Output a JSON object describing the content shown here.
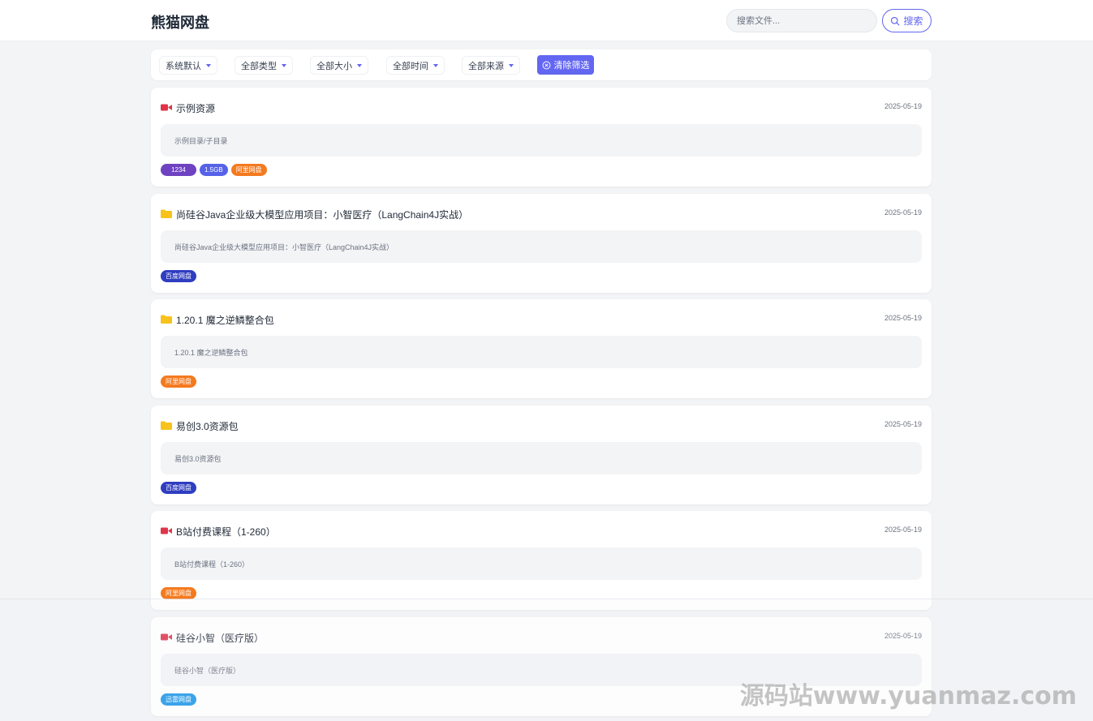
{
  "header": {
    "logo": "熊猫网盘",
    "search_placeholder": "搜索文件...",
    "search_button": "搜索"
  },
  "filters": {
    "sort": "系统默认",
    "type": "全部类型",
    "size": "全部大小",
    "time": "全部时间",
    "source": "全部来源",
    "clear": "清除筛选"
  },
  "results": [
    {
      "icon": "video-icon",
      "title": "示例资源",
      "date": "2025-05-19",
      "path": "示例目录/子目录",
      "tags": [
        {
          "text": "1234",
          "kind": "count"
        },
        {
          "text": "1.5GB",
          "kind": "size"
        },
        {
          "text": "阿里网盘",
          "kind": "aliyun"
        }
      ]
    },
    {
      "icon": "folder-icon",
      "title": "尚硅谷Java企业级大模型应用项目：小智医疗（LangChain4J实战）",
      "date": "2025-05-19",
      "path": "尚硅谷Java企业级大模型应用项目：小智医疗（LangChain4J实战）",
      "tags": [
        {
          "text": "百度网盘",
          "kind": "baidu"
        }
      ]
    },
    {
      "icon": "folder-icon",
      "title": "1.20.1 魔之逆鳞整合包",
      "date": "2025-05-19",
      "path": "1.20.1 魔之逆鳞整合包",
      "tags": [
        {
          "text": "阿里网盘",
          "kind": "aliyun"
        }
      ]
    },
    {
      "icon": "folder-icon",
      "title": "易创3.0资源包",
      "date": "2025-05-19",
      "path": "易创3.0资源包",
      "tags": [
        {
          "text": "百度网盘",
          "kind": "baidu"
        }
      ]
    },
    {
      "icon": "video-icon",
      "title": "B站付费课程（1-260）",
      "date": "2025-05-19",
      "path": "B站付费课程（1-260）",
      "tags": [
        {
          "text": "阿里网盘",
          "kind": "aliyun"
        }
      ]
    },
    {
      "icon": "video-icon",
      "title": "硅谷小智（医疗版）",
      "date": "2025-05-19",
      "path": "硅谷小智（医疗版）",
      "tags": [
        {
          "text": "迅雷网盘",
          "kind": "xunlei"
        }
      ]
    }
  ],
  "colors": {
    "accent": "#6366f1",
    "video_icon": "#e0344a",
    "folder_icon": "#f7c21b",
    "tag_count": "#6f42c1",
    "tag_size": "#5562e8",
    "tag_aliyun": "#f47a1f",
    "tag_baidu": "#2f3dc0",
    "tag_xunlei": "#1c97e7"
  },
  "watermark": "源码站www.yuanmaz.com"
}
